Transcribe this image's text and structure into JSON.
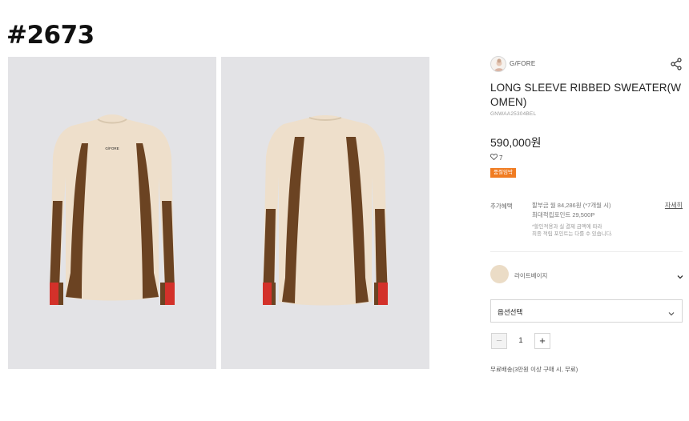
{
  "tag": "#2673",
  "brand": {
    "name": "G/FORE",
    "logo_icon": "brand-avatar-icon",
    "share_icon": "share-icon"
  },
  "product": {
    "title": "LONG SLEEVE RIBBED SWEATER(WOMEN)",
    "code": "GNWAA25304BEL",
    "price": "590,000원",
    "likes": "7",
    "badge": "품절임박",
    "photo_logo": "G/FORE"
  },
  "benefits": {
    "label": "추가혜택",
    "line1": "할부금 월 84,286원 (*7개월 시)",
    "line2": "최대적립포인트 29,500P",
    "note1": "*할인적용과 실 결제 금액에 따라",
    "note2": "최종 적립 포인트는 다를 수 있습니다.",
    "detail": "자세히"
  },
  "color": {
    "name": "라이트베이지",
    "swatch": "#ebdcc6"
  },
  "option": {
    "label": "옵션선택"
  },
  "quantity": {
    "value": "1",
    "minus": "−",
    "plus": "+"
  },
  "delivery": "무료배송(3만원 이상 구매 시, 무료)",
  "colors": {
    "badge": "#f07c22",
    "photo_bg": "#e3e3e6",
    "sweater": "#eedfcb",
    "panel": "#6b4322",
    "cuff": "#d3312a"
  }
}
